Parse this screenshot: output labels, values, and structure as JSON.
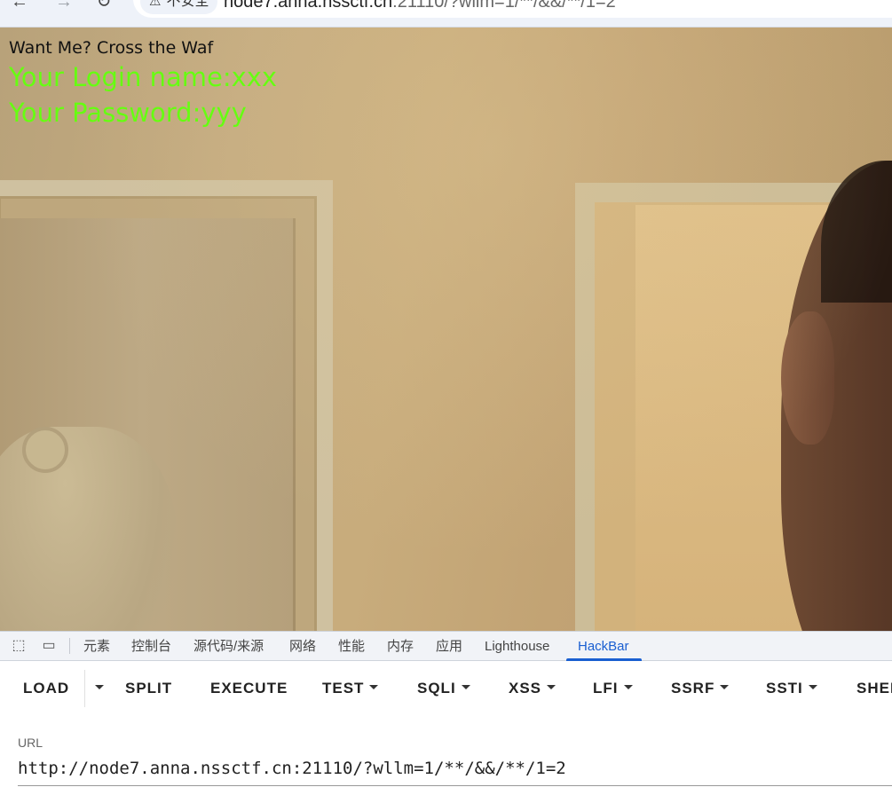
{
  "browser": {
    "back_icon": "back-arrow-icon",
    "forward_icon": "forward-arrow-icon",
    "reload_icon": "reload-icon",
    "security_label": "不安全",
    "url_host": "node7.anna.nssctf.cn",
    "url_rest": ":21110/?wllm=1/**/&&/**/1=2"
  },
  "page": {
    "banner": "Want Me? Cross the Waf",
    "login_name": "Your Login name:xxx",
    "password": "Your Password:yyy",
    "colors": {
      "login_text": "#66ff11",
      "banner_text": "#111111"
    }
  },
  "devtools": {
    "tabs": [
      {
        "label": "元素"
      },
      {
        "label": "控制台"
      },
      {
        "label": "源代码/来源"
      },
      {
        "label": "网络"
      },
      {
        "label": "性能"
      },
      {
        "label": "内存"
      },
      {
        "label": "应用"
      },
      {
        "label": "Lighthouse"
      },
      {
        "label": "HackBar"
      }
    ],
    "active_tab": "HackBar",
    "accent": "#1a5fd1"
  },
  "hackbar": {
    "buttons": {
      "load": "LOAD",
      "split": "SPLIT",
      "execute": "EXECUTE",
      "test": "TEST",
      "sqli": "SQLI",
      "xss": "XSS",
      "lfi": "LFI",
      "ssrf": "SSRF",
      "ssti": "SSTI",
      "shell": "SHEI"
    },
    "url_label": "URL",
    "url_value": "http://node7.anna.nssctf.cn:21110/?wllm=1/**/&&/**/1=2"
  }
}
